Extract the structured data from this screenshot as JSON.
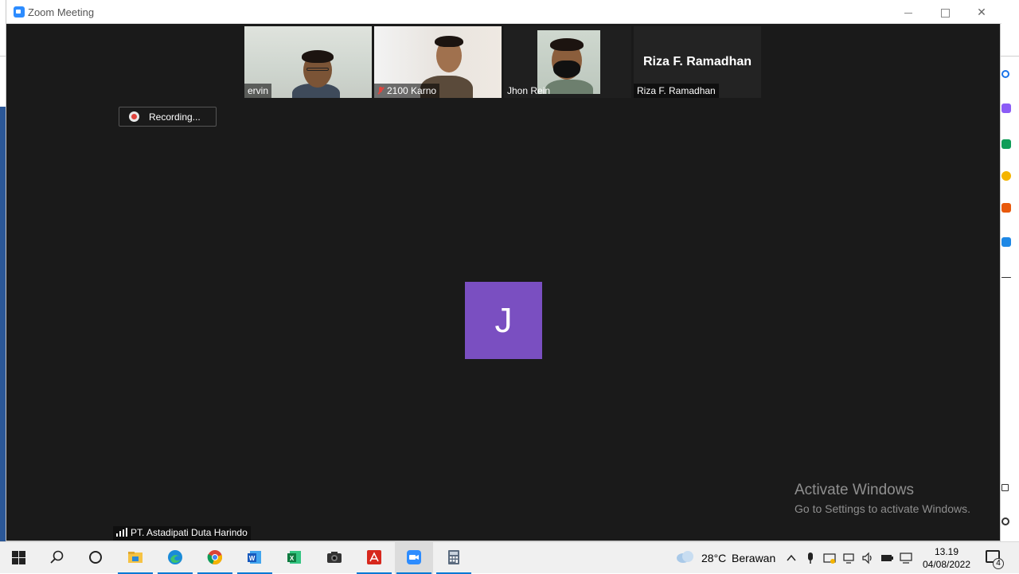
{
  "window": {
    "title": "Zoom Meeting",
    "controls": {
      "minimize": "—",
      "maximize": "□",
      "close": "✕"
    }
  },
  "participants": [
    {
      "name": "ervin",
      "muted": false,
      "video": true
    },
    {
      "name": "2100 Karno",
      "muted": true,
      "video": true
    },
    {
      "name": "Jhon Rein",
      "muted": false,
      "video": true
    },
    {
      "name": "Riza F. Ramadhan",
      "display_name": "Riza F. Ramadhan",
      "muted": false,
      "video": false
    }
  ],
  "recording": {
    "label": "Recording..."
  },
  "active_speaker": {
    "initial": "J",
    "color": "#7a4fc1"
  },
  "network": {
    "label": "PT. Astadipati Duta Harindo"
  },
  "watermark": {
    "line1": "Activate Windows",
    "line2": "Go to Settings to activate Windows."
  },
  "taskbar": {
    "apps": [
      "start",
      "search",
      "task-view",
      "file-explorer",
      "edge",
      "chrome",
      "word",
      "excel",
      "camera",
      "acrobat",
      "zoom",
      "calculator"
    ],
    "weather": {
      "temp": "28°C",
      "condition": "Berawan"
    },
    "clock": {
      "time": "13.19",
      "date": "04/08/2022"
    },
    "notifications": "4"
  }
}
